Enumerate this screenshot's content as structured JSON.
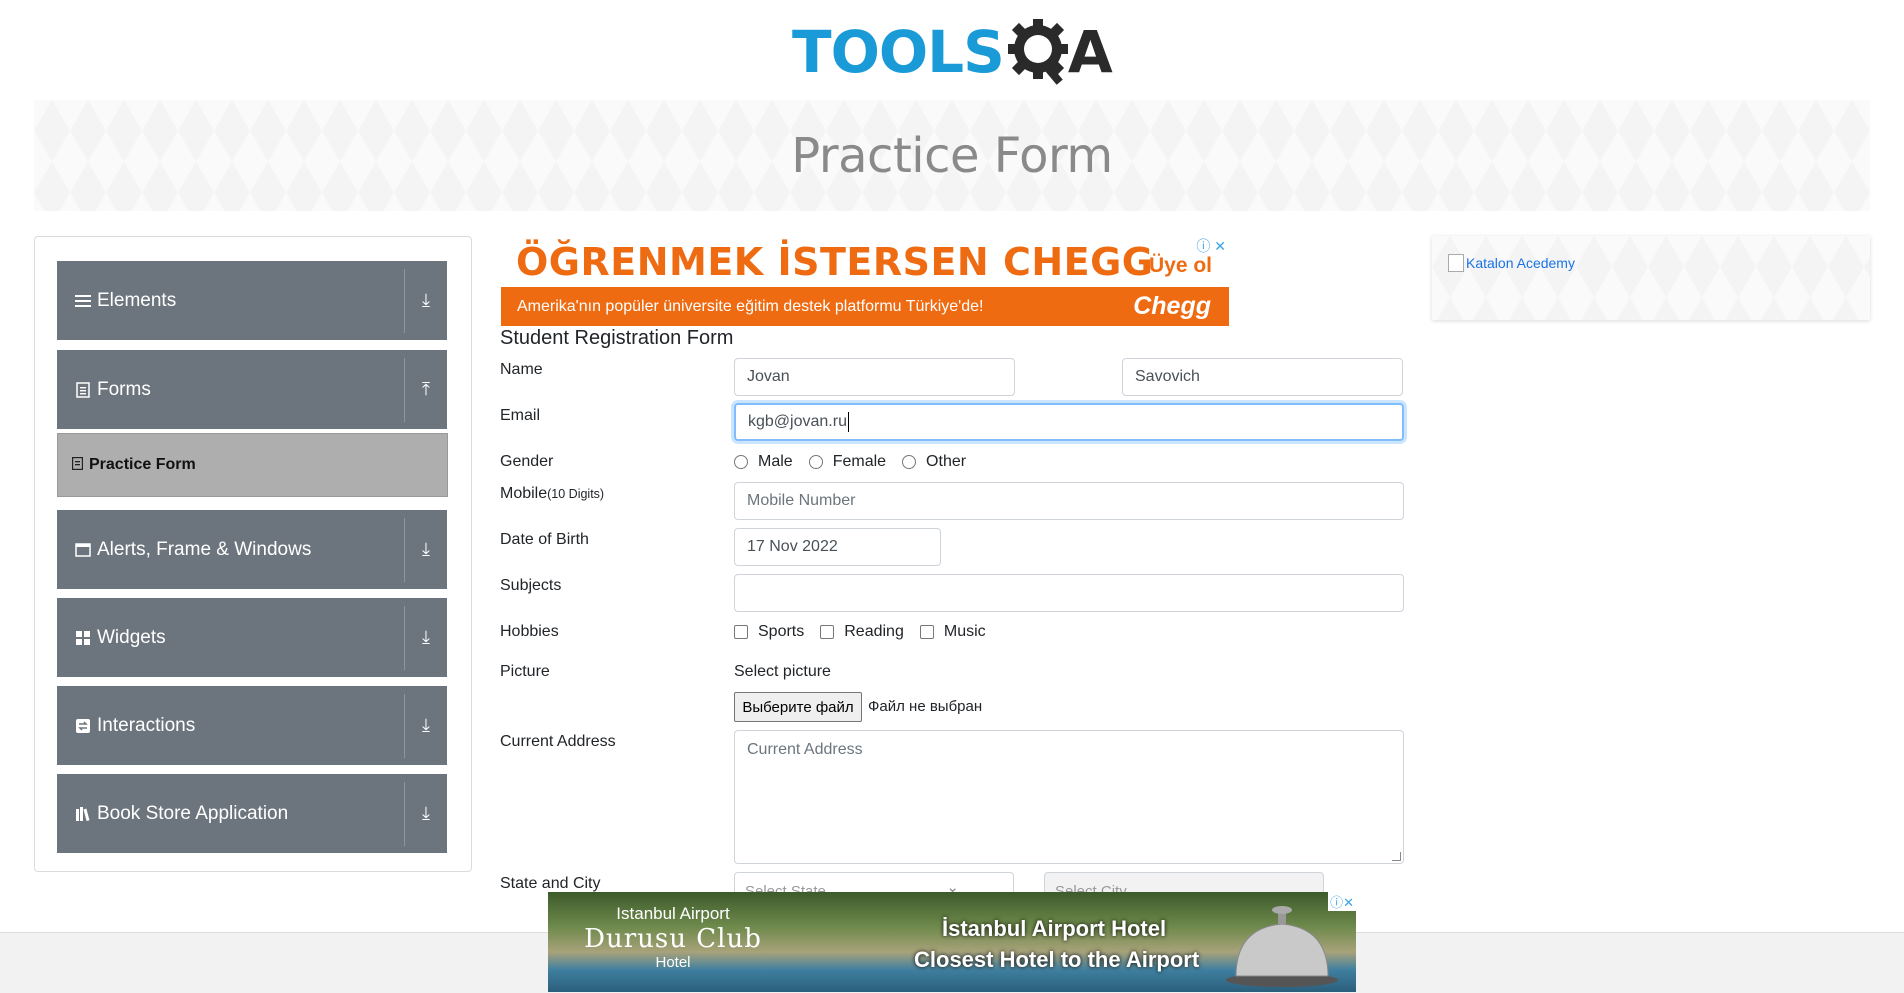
{
  "header": {
    "logo_text": "TOOLS",
    "logo_suffix": "A",
    "page_title": "Practice Form"
  },
  "sidebar": {
    "groups": [
      {
        "label": "Elements",
        "icon": "menu-icon",
        "expanded": false
      },
      {
        "label": "Forms",
        "icon": "document-icon",
        "expanded": true
      },
      {
        "label": "Alerts, Frame & Windows",
        "icon": "window-icon",
        "expanded": false
      },
      {
        "label": "Widgets",
        "icon": "grid-icon",
        "expanded": false
      },
      {
        "label": "Interactions",
        "icon": "interaction-icon",
        "expanded": false
      },
      {
        "label": "Book Store Application",
        "icon": "books-icon",
        "expanded": false
      }
    ],
    "active_item": "Practice Form"
  },
  "ad_top": {
    "headline": "ÖĞRENMEK İSTERSEN CHEGG",
    "cta": "Üye ol",
    "tagline": "Amerika'nın popüler üniversite eğitim destek platformu Türkiye'de!",
    "brand": "Chegg",
    "brand_color": "#ee6b12"
  },
  "form": {
    "title": "Student Registration Form",
    "name_label": "Name",
    "first_name_value": "Jovan",
    "last_name_value": "Savovich",
    "email_label": "Email",
    "email_value": "kgb@jovan.ru",
    "gender_label": "Gender",
    "gender_options": [
      "Male",
      "Female",
      "Other"
    ],
    "mobile_label": "Mobile",
    "mobile_hint": "(10 Digits)",
    "mobile_placeholder": "Mobile Number",
    "dob_label": "Date of Birth",
    "dob_value": "17 Nov 2022",
    "subjects_label": "Subjects",
    "hobbies_label": "Hobbies",
    "hobby_options": [
      "Sports",
      "Reading",
      "Music"
    ],
    "picture_label": "Picture",
    "select_picture_label": "Select picture",
    "file_button_label": "Выберите файл",
    "file_status": "Файл не выбран",
    "address_label": "Current Address",
    "address_placeholder": "Current Address",
    "state_city_label": "State and City",
    "state_placeholder": "Select State",
    "city_placeholder": "Select City"
  },
  "ad_right": {
    "alt_text": "Katalon Acedemy"
  },
  "ad_bottom": {
    "brand_line1": "Istanbul Airport",
    "brand_line2": "Durusu Club",
    "brand_line3": "Hotel",
    "headline1": "İstanbul Airport Hotel",
    "headline2": "Closest Hotel to the Airport"
  },
  "colors": {
    "logo_blue": "#1a9bd7",
    "sidebar_bg": "#6c757d",
    "active_item_bg": "#aeaeae",
    "focus_border": "#80bdff"
  }
}
